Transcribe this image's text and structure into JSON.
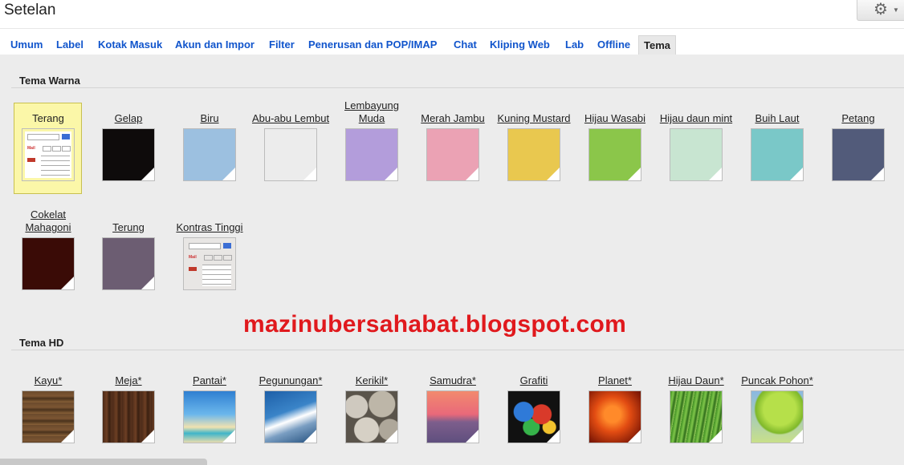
{
  "header": {
    "title": "Setelan",
    "gear_icon": "gear-icon",
    "caret_icon": "chevron-down-icon"
  },
  "tabs": [
    {
      "label": "Umum"
    },
    {
      "label": "Label"
    },
    {
      "label": "Kotak Masuk"
    },
    {
      "label": "Akun dan Impor"
    },
    {
      "label": "Filter"
    },
    {
      "label": "Penerusan dan POP/IMAP"
    },
    {
      "label": "Chat"
    },
    {
      "label": "Kliping Web"
    },
    {
      "label": "Lab"
    },
    {
      "label": "Offline"
    },
    {
      "label": "Tema",
      "active": true
    }
  ],
  "color_themes": {
    "title": "Tema Warna",
    "items": [
      {
        "label": "Terang",
        "color": "#ffffff",
        "selected": true
      },
      {
        "label": "Gelap",
        "color": "#0e0b0b"
      },
      {
        "label": "Biru",
        "color": "#9cc0e0"
      },
      {
        "label": "Abu-abu Lembut",
        "color": "#ececec"
      },
      {
        "label": "Lembayung Muda",
        "color": "#b39ddb"
      },
      {
        "label": "Merah Jambu",
        "color": "#eba2b4"
      },
      {
        "label": "Kuning Mustard",
        "color": "#e9c84f"
      },
      {
        "label": "Hijau Wasabi",
        "color": "#8bc64a"
      },
      {
        "label": "Hijau daun mint",
        "color": "#c8e5d1"
      },
      {
        "label": "Buih Laut",
        "color": "#7ac8c8"
      },
      {
        "label": "Petang",
        "color": "#525b7a"
      },
      {
        "label": "Cokelat Mahagoni",
        "color": "#3a0b06"
      },
      {
        "label": "Terung",
        "color": "#6c5d72"
      },
      {
        "label": "Kontras Tinggi",
        "color": "#e8e6e4"
      }
    ]
  },
  "hd_themes": {
    "title": "Tema HD",
    "items": [
      {
        "label": "Kayu*",
        "image": "wood"
      },
      {
        "label": "Meja*",
        "image": "table"
      },
      {
        "label": "Pantai*",
        "image": "beach"
      },
      {
        "label": "Pegunungan*",
        "image": "mountain"
      },
      {
        "label": "Kerikil*",
        "image": "pebbles"
      },
      {
        "label": "Samudra*",
        "image": "ocean"
      },
      {
        "label": "Grafiti",
        "image": "graffiti"
      },
      {
        "label": "Planet*",
        "image": "planet"
      },
      {
        "label": "Hijau Daun*",
        "image": "green-leaf"
      },
      {
        "label": "Puncak Pohon*",
        "image": "treetop"
      }
    ]
  },
  "mock_preview": {
    "mail_label": "Mail"
  },
  "watermark": "mazinubersahabat.blogspot.com"
}
